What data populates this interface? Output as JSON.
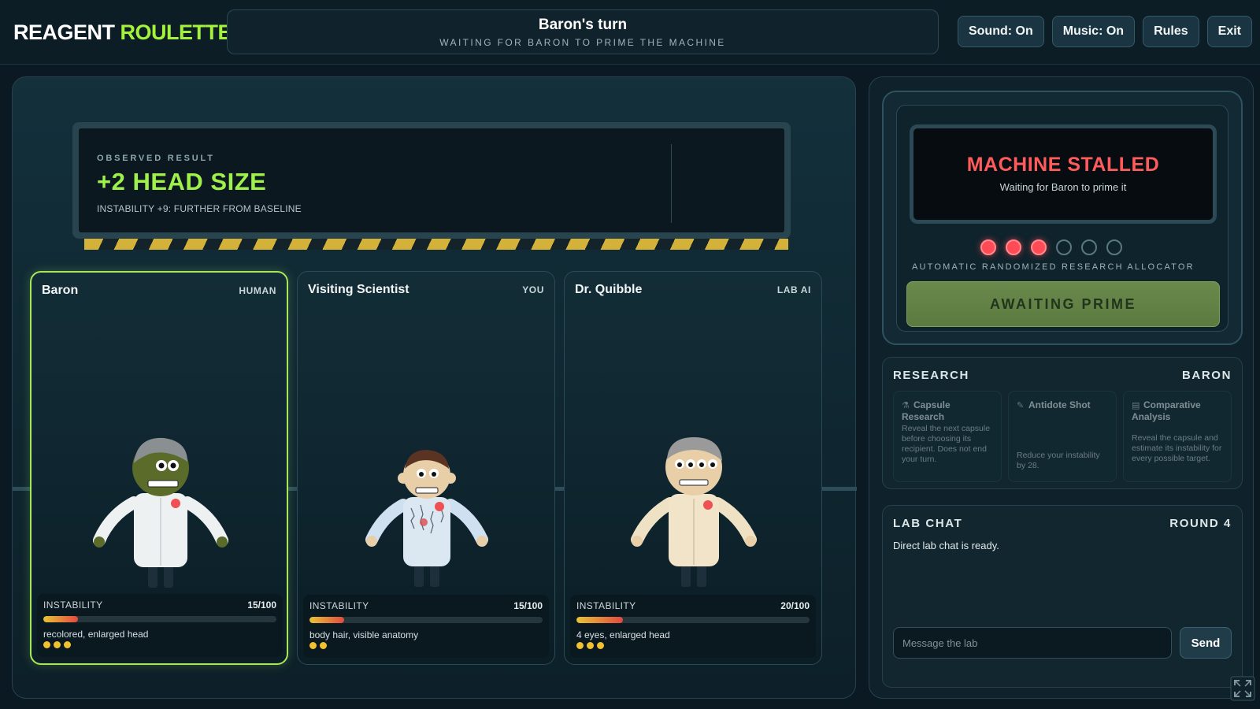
{
  "app": {
    "title_white": "REAGENT",
    "title_green": "ROULETTE"
  },
  "turn": {
    "title": "Baron's turn",
    "subtitle": "WAITING FOR BARON TO PRIME THE MACHINE"
  },
  "toolbar": {
    "sound": "Sound: On",
    "music": "Music: On",
    "rules": "Rules",
    "exit": "Exit"
  },
  "result": {
    "label": "OBSERVED RESULT",
    "value": "+2 HEAD SIZE",
    "note": "INSTABILITY +9: FURTHER FROM BASELINE"
  },
  "players": [
    {
      "name": "Baron",
      "role": "HUMAN",
      "instability_label": "INSTABILITY",
      "instability_text": "15/100",
      "instability": 15,
      "traits": "recolored, enlarged head",
      "dots": 3,
      "active": true,
      "skin": "#5a6b2a",
      "hair": "#8a8f92"
    },
    {
      "name": "Visiting Scientist",
      "role": "YOU",
      "instability_label": "INSTABILITY",
      "instability_text": "15/100",
      "instability": 15,
      "traits": "body hair, visible anatomy",
      "dots": 2,
      "active": false,
      "skin": "#e8cfa8",
      "hair": "#5a3322"
    },
    {
      "name": "Dr. Quibble",
      "role": "LAB AI",
      "instability_label": "INSTABILITY",
      "instability_text": "20/100",
      "instability": 20,
      "traits": "4 eyes, enlarged head",
      "dots": 3,
      "active": false,
      "skin": "#e8cfa8",
      "hair": "#9a9a9a"
    }
  ],
  "machine": {
    "status": "MACHINE STALLED",
    "status_sub": "Waiting for Baron to prime it",
    "lights_total": 6,
    "lights_on": 3,
    "allocator_label": "AUTOMATIC RANDOMIZED RESEARCH ALLOCATOR",
    "prime_button": "AWAITING PRIME"
  },
  "research": {
    "title": "RESEARCH",
    "owner": "BARON",
    "items": [
      {
        "title": "Capsule Research",
        "desc": "Reveal the next capsule before choosing its recipient. Does not end your turn.",
        "icon": "flask-icon"
      },
      {
        "title": "Antidote Shot",
        "desc": "Reduce your instability by 28.",
        "icon": "syringe-icon"
      },
      {
        "title": "Comparative Analysis",
        "desc": "Reveal the capsule and estimate its instability for every possible target.",
        "icon": "chart-icon"
      }
    ]
  },
  "chat": {
    "title": "LAB CHAT",
    "round": "ROUND 4",
    "message": "Direct lab chat is ready.",
    "placeholder": "Message the lab",
    "send": "Send"
  },
  "colors": {
    "accent": "#a4f23a",
    "danger": "#ff5b5b",
    "warning": "#f2c12f"
  }
}
